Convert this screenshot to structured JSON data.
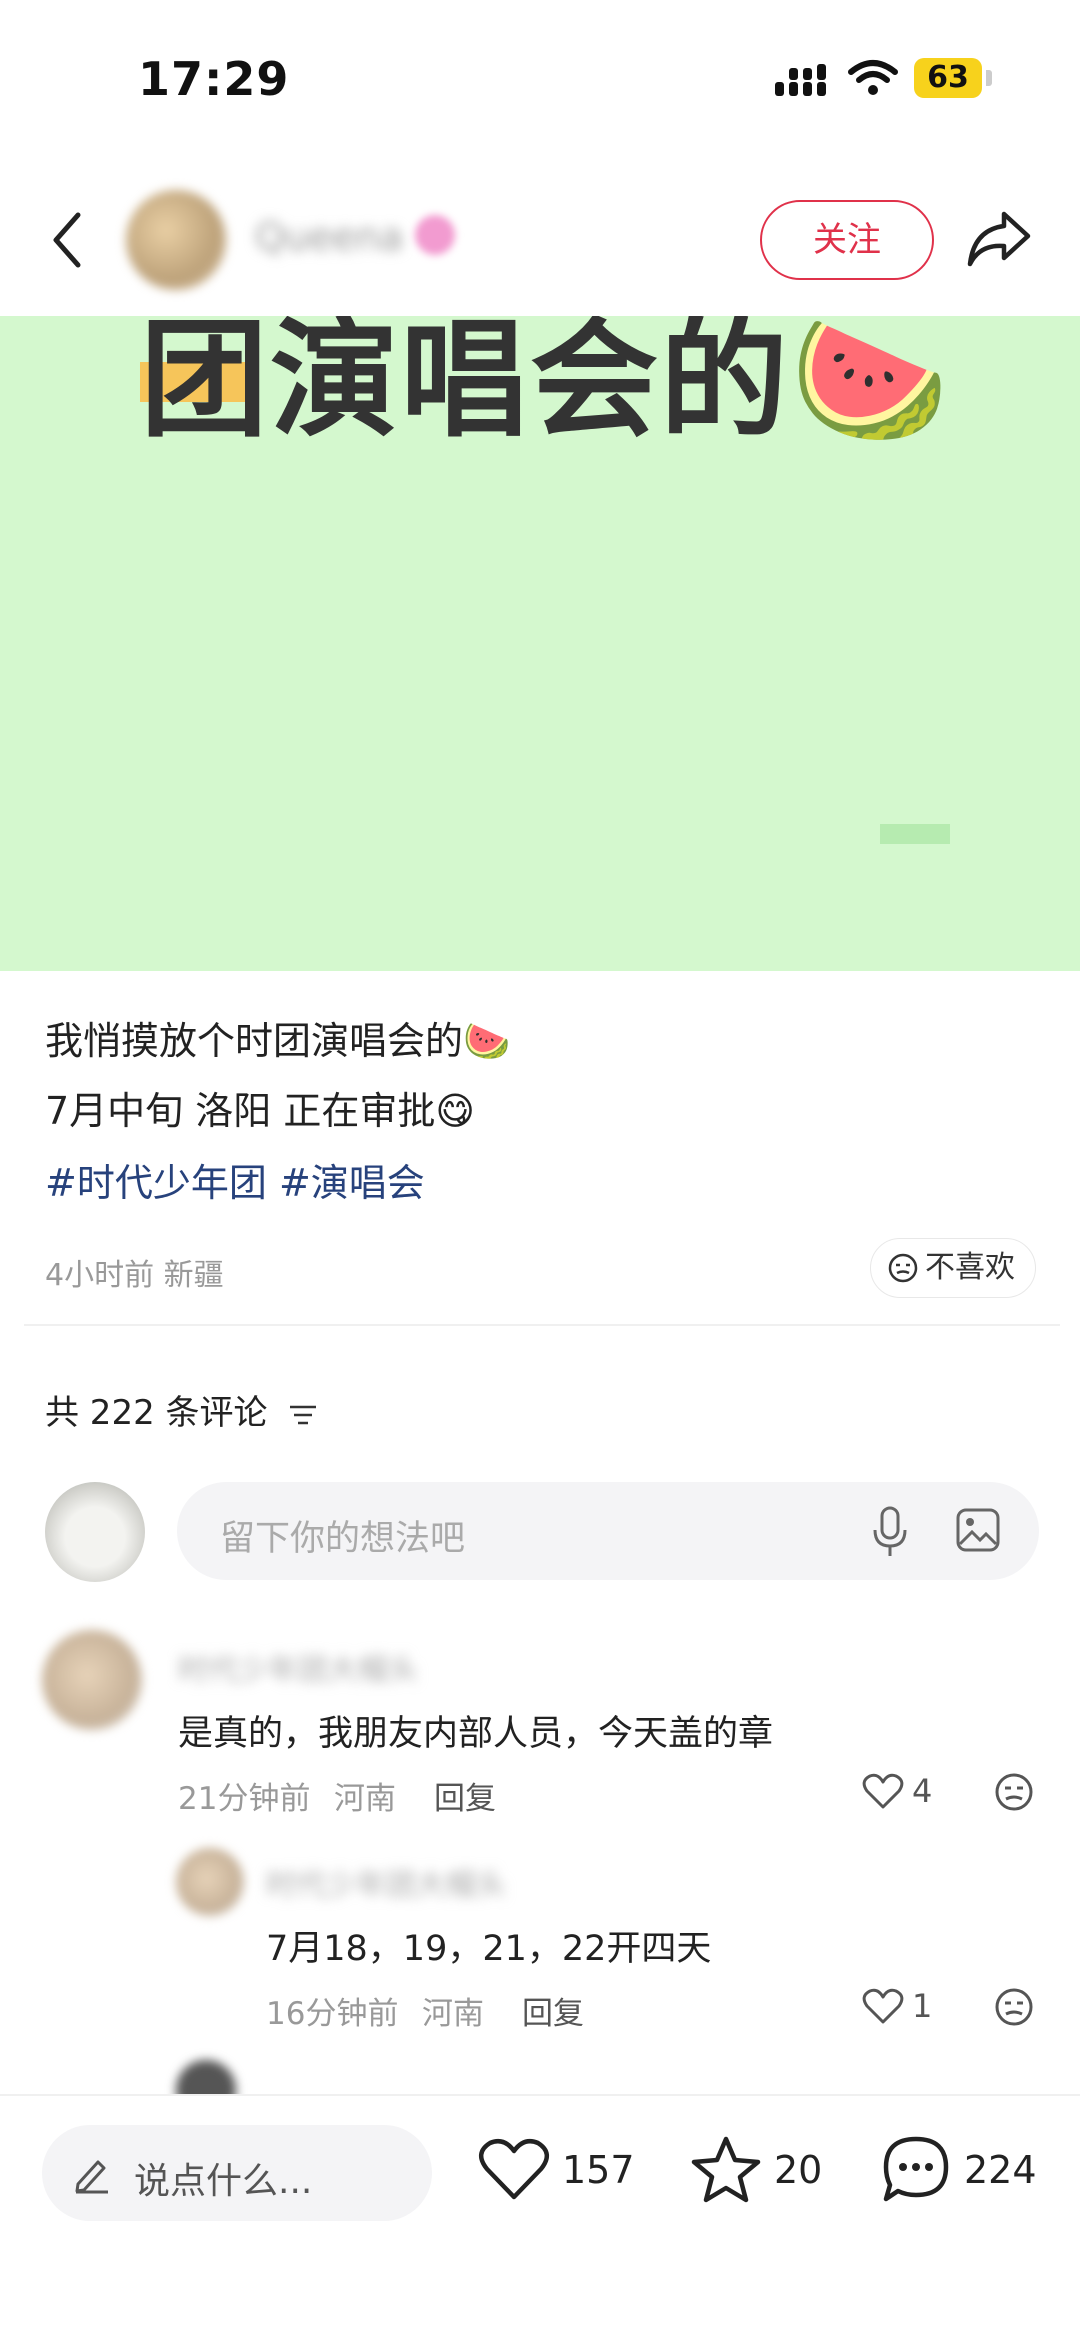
{
  "status_bar": {
    "time": "17:29",
    "battery": "63"
  },
  "header": {
    "username": "Queena",
    "follow_label": "关注"
  },
  "image": {
    "banner_text": "团演唱会的🍉"
  },
  "post": {
    "line1": "我悄摸放个时团演唱会的🍉",
    "line2": "7月中旬 洛阳 正在审批😋",
    "tags": [
      "#时代少年团",
      "#演唱会"
    ],
    "meta": "4小时前 新疆",
    "dislike_label": "不喜欢"
  },
  "comments_section": {
    "count_label": "共 222 条评论",
    "input_placeholder": "留下你的想法吧"
  },
  "comments": [
    {
      "name": "时代少年团大帽头",
      "text": "是真的，我朋友内部人员，今天盖的章",
      "time": "21分钟前",
      "location": "河南",
      "reply_label": "回复",
      "likes": "4"
    },
    {
      "name": "时代少年团大帽头",
      "text": "7月18，19，21，22开四天",
      "time": "16分钟前",
      "location": "河南",
      "reply_label": "回复",
      "likes": "1"
    }
  ],
  "bottom_bar": {
    "say_placeholder": "说点什么...",
    "likes": "157",
    "favorites": "20",
    "comments": "224"
  },
  "colors": {
    "accent": "#e0314a",
    "tag": "#27427c",
    "image_bg": "#d4f8ce"
  }
}
